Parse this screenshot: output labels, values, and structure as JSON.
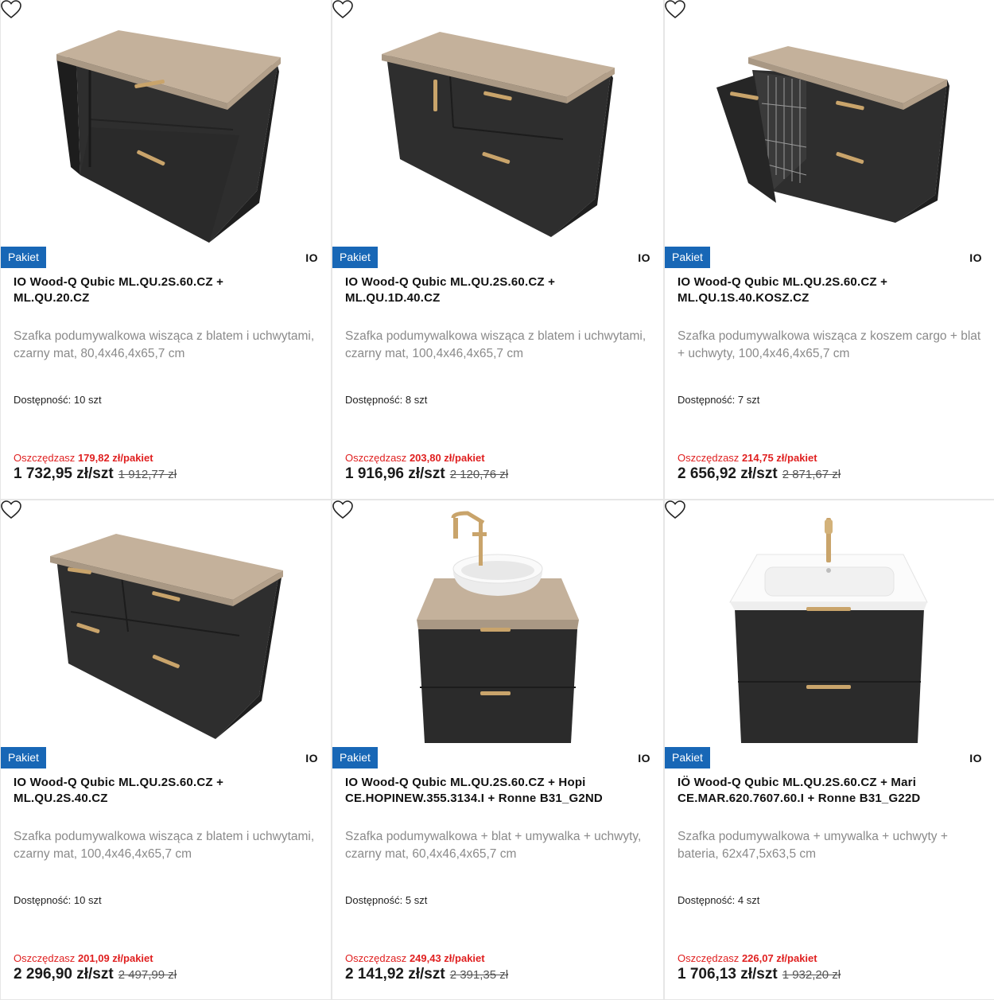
{
  "colors": {
    "badge": "#1867b6",
    "save": "#e02020",
    "cabinet": "#2b2b2b",
    "wood": "#c2b09a",
    "handle": "#c9a46b"
  },
  "products": [
    {
      "badge": "Pakiet",
      "brand": "IO",
      "title": "IO Wood-Q Qubic ML.QU.2S.60.CZ + ML.QU.20.CZ",
      "desc": "Szafka podumywalkowa wisząca z blatem i uchwytami, czarny mat, 80,4x46,4x65,7 cm",
      "availability": "Dostępność: 10 szt",
      "save_label": "Oszczędzasz",
      "save_amount": "179,82 zł/pakiet",
      "price": "1 732,95 zł/szt",
      "old_price": "1 912,77 zł",
      "icon": "heart-outline-icon"
    },
    {
      "badge": "Pakiet",
      "brand": "IO",
      "title": "IO Wood-Q Qubic ML.QU.2S.60.CZ + ML.QU.1D.40.CZ",
      "desc": "Szafka podumywalkowa wisząca z blatem i uchwytami, czarny mat, 100,4x46,4x65,7 cm",
      "availability": "Dostępność: 8 szt",
      "save_label": "Oszczędzasz",
      "save_amount": "203,80 zł/pakiet",
      "price": "1 916,96 zł/szt",
      "old_price": "2 120,76 zł",
      "icon": "heart-outline-icon"
    },
    {
      "badge": "Pakiet",
      "brand": "IO",
      "title": "IO Wood-Q Qubic ML.QU.2S.60.CZ + ML.QU.1S.40.KOSZ.CZ",
      "desc": "Szafka podumywalkowa wisząca z koszem cargo + blat + uchwyty, 100,4x46,4x65,7 cm",
      "availability": "Dostępność: 7 szt",
      "save_label": "Oszczędzasz",
      "save_amount": "214,75 zł/pakiet",
      "price": "2 656,92 zł/szt",
      "old_price": "2 871,67 zł",
      "icon": "heart-outline-icon"
    },
    {
      "badge": "Pakiet",
      "brand": "IO",
      "title": "IO Wood-Q Qubic ML.QU.2S.60.CZ + ML.QU.2S.40.CZ",
      "desc": "Szafka podumywalkowa wisząca z blatem i uchwytami, czarny mat, 100,4x46,4x65,7 cm",
      "availability": "Dostępność: 10 szt",
      "save_label": "Oszczędzasz",
      "save_amount": "201,09 zł/pakiet",
      "price": "2 296,90 zł/szt",
      "old_price": "2 497,99 zł",
      "icon": "heart-outline-icon"
    },
    {
      "badge": "Pakiet",
      "brand": "IO",
      "title": "IO Wood-Q Qubic ML.QU.2S.60.CZ + Hopi CE.HOPINEW.355.3134.I + Ronne B31_G2ND",
      "desc": "Szafka podumywalkowa + blat + umywalka + uchwyty, czarny mat, 60,4x46,4x65,7 cm",
      "availability": "Dostępność: 5 szt",
      "save_label": "Oszczędzasz",
      "save_amount": "249,43 zł/pakiet",
      "price": "2 141,92 zł/szt",
      "old_price": "2 391,35 zł",
      "icon": "heart-outline-icon"
    },
    {
      "badge": "Pakiet",
      "brand": "IO",
      "title": "IÖ Wood-Q Qubic ML.QU.2S.60.CZ + Mari CE.MAR.620.7607.60.I + Ronne B31_G22D",
      "desc": "Szafka podumywalkowa + umywalka + uchwyty + bateria, 62x47,5x63,5 cm",
      "availability": "Dostępność: 4 szt",
      "save_label": "Oszczędzasz",
      "save_amount": "226,07 zł/pakiet",
      "price": "1 706,13 zł/szt",
      "old_price": "1 932,20 zł",
      "icon": "heart-outline-icon"
    }
  ]
}
